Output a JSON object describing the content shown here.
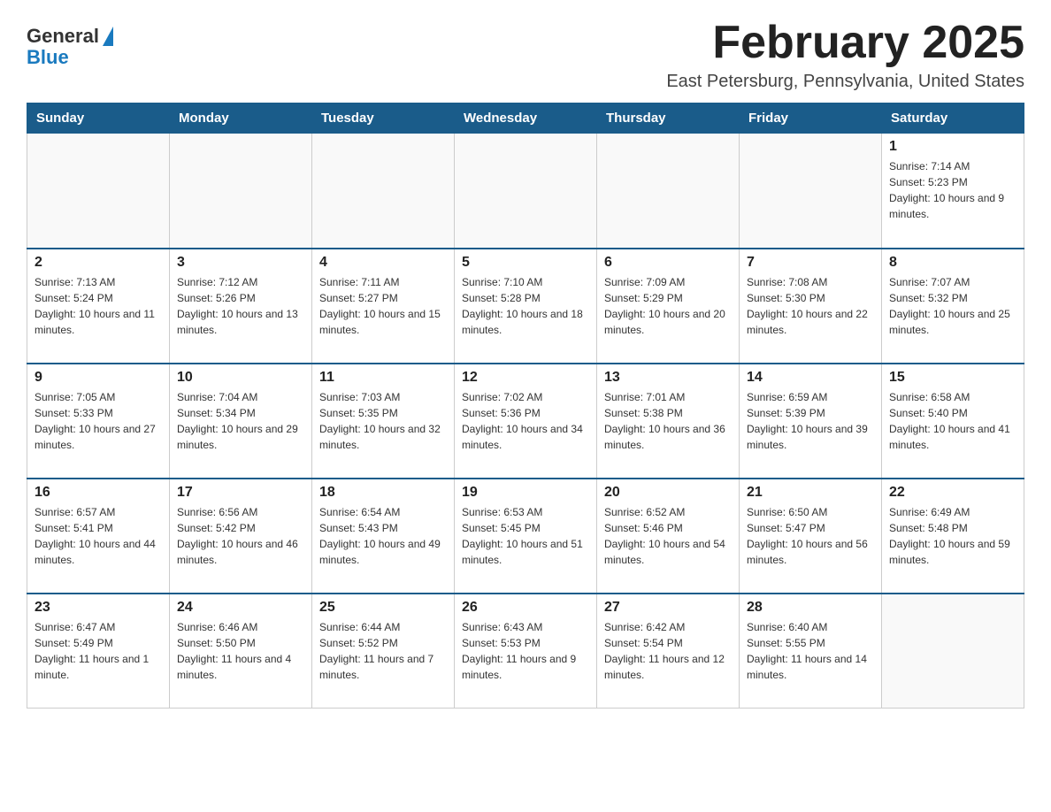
{
  "header": {
    "logo_general": "General",
    "logo_blue": "Blue",
    "month_title": "February 2025",
    "location": "East Petersburg, Pennsylvania, United States"
  },
  "days_of_week": [
    "Sunday",
    "Monday",
    "Tuesday",
    "Wednesday",
    "Thursday",
    "Friday",
    "Saturday"
  ],
  "weeks": [
    {
      "cells": [
        {
          "day": "",
          "info": ""
        },
        {
          "day": "",
          "info": ""
        },
        {
          "day": "",
          "info": ""
        },
        {
          "day": "",
          "info": ""
        },
        {
          "day": "",
          "info": ""
        },
        {
          "day": "",
          "info": ""
        },
        {
          "day": "1",
          "info": "Sunrise: 7:14 AM\nSunset: 5:23 PM\nDaylight: 10 hours and 9 minutes."
        }
      ]
    },
    {
      "cells": [
        {
          "day": "2",
          "info": "Sunrise: 7:13 AM\nSunset: 5:24 PM\nDaylight: 10 hours and 11 minutes."
        },
        {
          "day": "3",
          "info": "Sunrise: 7:12 AM\nSunset: 5:26 PM\nDaylight: 10 hours and 13 minutes."
        },
        {
          "day": "4",
          "info": "Sunrise: 7:11 AM\nSunset: 5:27 PM\nDaylight: 10 hours and 15 minutes."
        },
        {
          "day": "5",
          "info": "Sunrise: 7:10 AM\nSunset: 5:28 PM\nDaylight: 10 hours and 18 minutes."
        },
        {
          "day": "6",
          "info": "Sunrise: 7:09 AM\nSunset: 5:29 PM\nDaylight: 10 hours and 20 minutes."
        },
        {
          "day": "7",
          "info": "Sunrise: 7:08 AM\nSunset: 5:30 PM\nDaylight: 10 hours and 22 minutes."
        },
        {
          "day": "8",
          "info": "Sunrise: 7:07 AM\nSunset: 5:32 PM\nDaylight: 10 hours and 25 minutes."
        }
      ]
    },
    {
      "cells": [
        {
          "day": "9",
          "info": "Sunrise: 7:05 AM\nSunset: 5:33 PM\nDaylight: 10 hours and 27 minutes."
        },
        {
          "day": "10",
          "info": "Sunrise: 7:04 AM\nSunset: 5:34 PM\nDaylight: 10 hours and 29 minutes."
        },
        {
          "day": "11",
          "info": "Sunrise: 7:03 AM\nSunset: 5:35 PM\nDaylight: 10 hours and 32 minutes."
        },
        {
          "day": "12",
          "info": "Sunrise: 7:02 AM\nSunset: 5:36 PM\nDaylight: 10 hours and 34 minutes."
        },
        {
          "day": "13",
          "info": "Sunrise: 7:01 AM\nSunset: 5:38 PM\nDaylight: 10 hours and 36 minutes."
        },
        {
          "day": "14",
          "info": "Sunrise: 6:59 AM\nSunset: 5:39 PM\nDaylight: 10 hours and 39 minutes."
        },
        {
          "day": "15",
          "info": "Sunrise: 6:58 AM\nSunset: 5:40 PM\nDaylight: 10 hours and 41 minutes."
        }
      ]
    },
    {
      "cells": [
        {
          "day": "16",
          "info": "Sunrise: 6:57 AM\nSunset: 5:41 PM\nDaylight: 10 hours and 44 minutes."
        },
        {
          "day": "17",
          "info": "Sunrise: 6:56 AM\nSunset: 5:42 PM\nDaylight: 10 hours and 46 minutes."
        },
        {
          "day": "18",
          "info": "Sunrise: 6:54 AM\nSunset: 5:43 PM\nDaylight: 10 hours and 49 minutes."
        },
        {
          "day": "19",
          "info": "Sunrise: 6:53 AM\nSunset: 5:45 PM\nDaylight: 10 hours and 51 minutes."
        },
        {
          "day": "20",
          "info": "Sunrise: 6:52 AM\nSunset: 5:46 PM\nDaylight: 10 hours and 54 minutes."
        },
        {
          "day": "21",
          "info": "Sunrise: 6:50 AM\nSunset: 5:47 PM\nDaylight: 10 hours and 56 minutes."
        },
        {
          "day": "22",
          "info": "Sunrise: 6:49 AM\nSunset: 5:48 PM\nDaylight: 10 hours and 59 minutes."
        }
      ]
    },
    {
      "cells": [
        {
          "day": "23",
          "info": "Sunrise: 6:47 AM\nSunset: 5:49 PM\nDaylight: 11 hours and 1 minute."
        },
        {
          "day": "24",
          "info": "Sunrise: 6:46 AM\nSunset: 5:50 PM\nDaylight: 11 hours and 4 minutes."
        },
        {
          "day": "25",
          "info": "Sunrise: 6:44 AM\nSunset: 5:52 PM\nDaylight: 11 hours and 7 minutes."
        },
        {
          "day": "26",
          "info": "Sunrise: 6:43 AM\nSunset: 5:53 PM\nDaylight: 11 hours and 9 minutes."
        },
        {
          "day": "27",
          "info": "Sunrise: 6:42 AM\nSunset: 5:54 PM\nDaylight: 11 hours and 12 minutes."
        },
        {
          "day": "28",
          "info": "Sunrise: 6:40 AM\nSunset: 5:55 PM\nDaylight: 11 hours and 14 minutes."
        },
        {
          "day": "",
          "info": ""
        }
      ]
    }
  ]
}
